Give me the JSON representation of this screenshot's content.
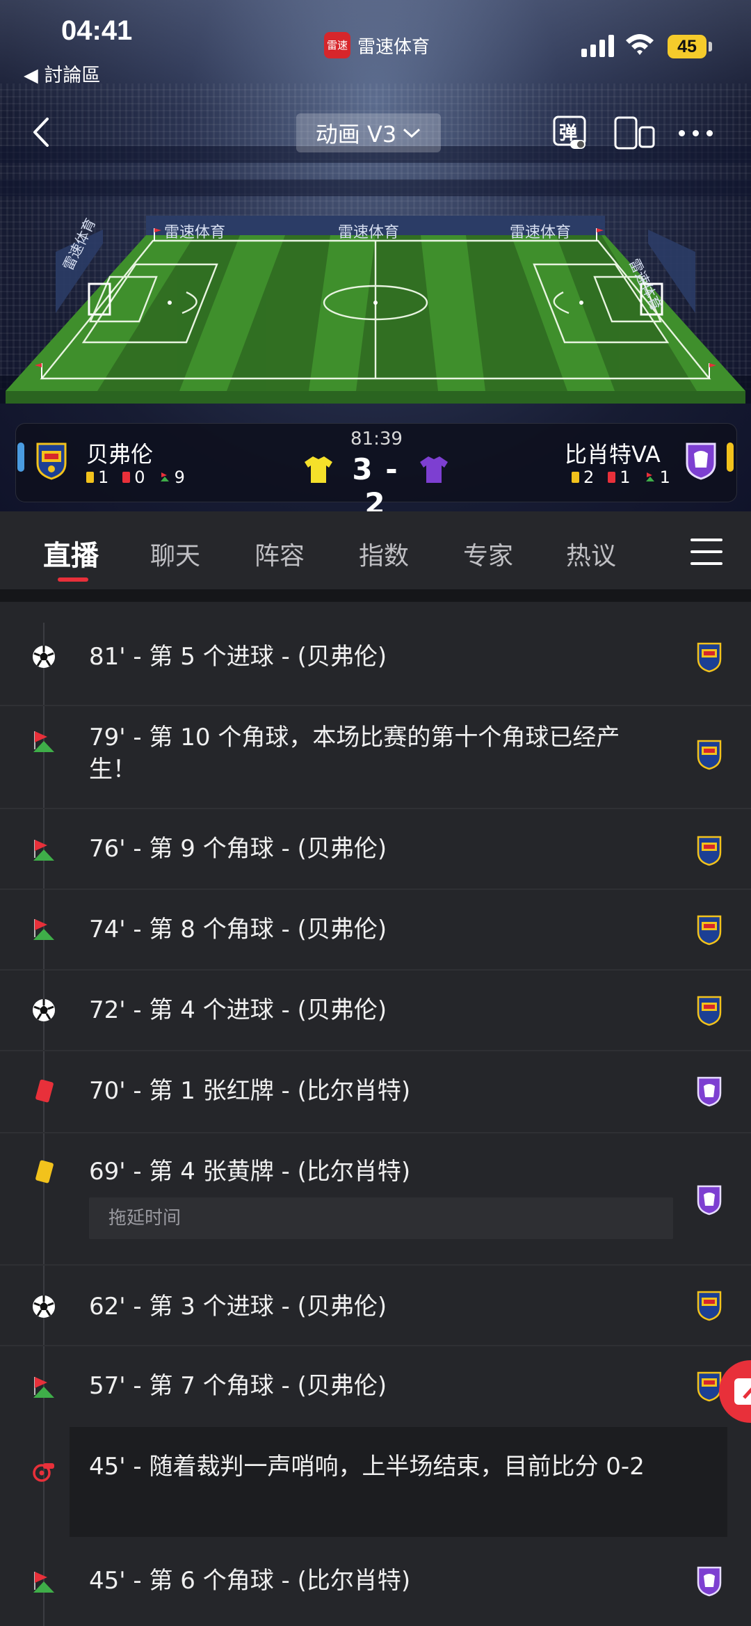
{
  "status_bar": {
    "time": "04:41",
    "back_app": "◀ 討論區",
    "app_name": "雷速体育",
    "app_logo_text": "雷速",
    "battery": "45"
  },
  "nav": {
    "mode_label": "动画 V3",
    "danmu_label": "弹"
  },
  "stadium": {
    "brand_boards": [
      "雷速体育",
      "雷速体育",
      "雷速体育"
    ],
    "side_boards": [
      "雷速体育",
      "雷速体育"
    ]
  },
  "match": {
    "clock": "81:39",
    "score": "3 - 2",
    "home": {
      "name": "贝弗伦",
      "yellow": "1",
      "red": "0",
      "corners": "9",
      "jersey_color": "#f5e02a",
      "accent": "#4a9be0"
    },
    "away": {
      "name": "比肖特VA",
      "yellow": "2",
      "red": "1",
      "corners": "1",
      "jersey_color": "#7d3fd1",
      "accent": "#f2c21c"
    }
  },
  "tabs": [
    "直播",
    "聊天",
    "阵容",
    "指数",
    "专家",
    "热议"
  ],
  "active_tab": "直播",
  "events": [
    {
      "type": "goal",
      "text": "81' - 第 5 个进球 - (贝弗伦)",
      "team": "home"
    },
    {
      "type": "corner",
      "text": "79' - 第 10 个角球，本场比赛的第十个角球已经产生！",
      "team": "home"
    },
    {
      "type": "corner",
      "text": "76' - 第 9 个角球 - (贝弗伦)",
      "team": "home"
    },
    {
      "type": "corner",
      "text": "74' - 第 8 个角球 - (贝弗伦)",
      "team": "home"
    },
    {
      "type": "goal",
      "text": "72' - 第 4 个进球 - (贝弗伦)",
      "team": "home"
    },
    {
      "type": "red-card",
      "text": "70' - 第 1 张红牌 - (比尔肖特)",
      "team": "away"
    },
    {
      "type": "yellow-card",
      "text": "69' - 第 4 张黄牌 - (比尔肖特)",
      "note": "拖延时间",
      "team": "away"
    },
    {
      "type": "goal",
      "text": "62' - 第 3 个进球 - (贝弗伦)",
      "team": "home"
    },
    {
      "type": "corner",
      "text": "57' - 第 7 个角球 - (贝弗伦)",
      "team": "home"
    },
    {
      "type": "whistle",
      "text": "45' - 随着裁判一声哨响，上半场结束，目前比分 0-2",
      "team": "none"
    },
    {
      "type": "corner",
      "text": "45' - 第 6 个角球 - (比尔肖特)",
      "team": "away"
    }
  ]
}
